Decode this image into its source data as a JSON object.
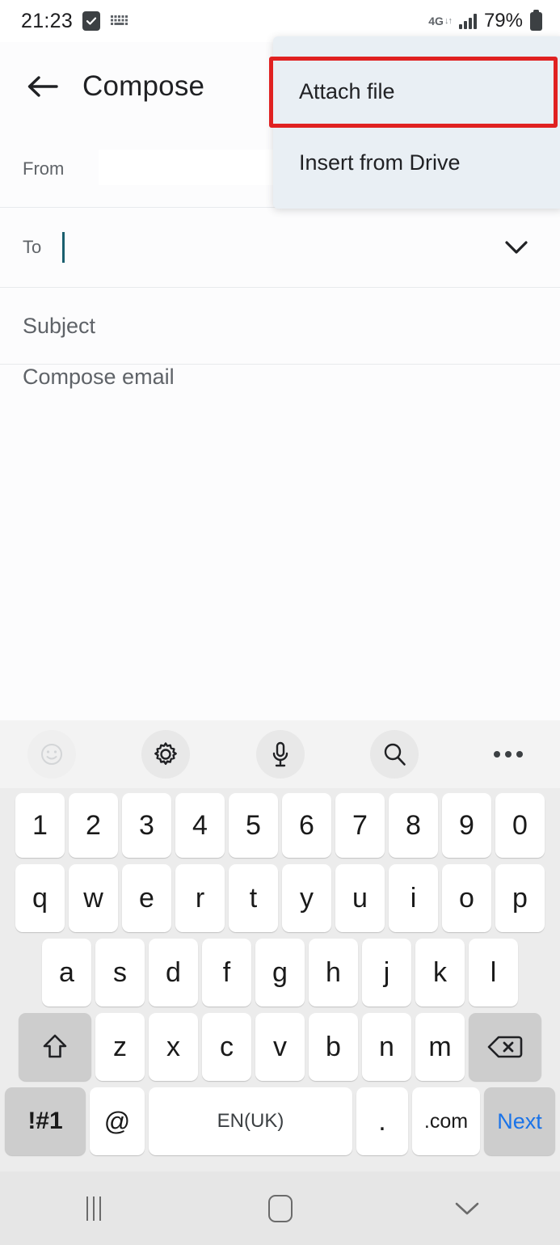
{
  "status_bar": {
    "time": "21:23",
    "check_icon": "checkbox-checked-icon",
    "keyboard_icon": "keyboard-icon",
    "network_type": "4G",
    "data_arrows": "↓↑",
    "signal_icon": "signal-bars-icon",
    "battery_percent": "79%",
    "battery_icon": "battery-full-icon"
  },
  "app_bar": {
    "back_icon": "back-arrow-icon",
    "title": "Compose"
  },
  "compose": {
    "from_label": "From",
    "from_value": "",
    "from_trailing": ")",
    "to_label": "To",
    "to_value": "",
    "to_expand_icon": "chevron-down-icon",
    "subject_placeholder": "Subject",
    "subject_value": "",
    "body_placeholder": "Compose email",
    "body_value": ""
  },
  "overflow_menu": {
    "visible": true,
    "background_color": "#e9eff4",
    "highlight_color": "#e02121",
    "items": [
      {
        "label": "Attach file",
        "highlighted": true
      },
      {
        "label": "Insert from Drive",
        "highlighted": false
      }
    ]
  },
  "keyboard": {
    "toolbar": [
      {
        "name": "emoji-icon",
        "label": ""
      },
      {
        "name": "gear-icon",
        "label": ""
      },
      {
        "name": "microphone-icon",
        "label": ""
      },
      {
        "name": "search-icon",
        "label": ""
      },
      {
        "name": "overflow-dots-icon",
        "label": ""
      }
    ],
    "row_numbers": [
      "1",
      "2",
      "3",
      "4",
      "5",
      "6",
      "7",
      "8",
      "9",
      "0"
    ],
    "row_top": [
      "q",
      "w",
      "e",
      "r",
      "t",
      "y",
      "u",
      "i",
      "o",
      "p"
    ],
    "row_home": [
      "a",
      "s",
      "d",
      "f",
      "g",
      "h",
      "j",
      "k",
      "l"
    ],
    "row_bottom": [
      "z",
      "x",
      "c",
      "v",
      "b",
      "n",
      "m"
    ],
    "shift_icon": "shift-arrow-icon",
    "backspace_icon": "backspace-icon",
    "symbols_key": "!#1",
    "at_key": "@",
    "space_key": "EN(UK)",
    "period_key": ".",
    "dotcom_key": ".com",
    "action_key": "Next",
    "action_key_color": "#1a73e8"
  },
  "nav_bar": {
    "recents_icon": "recents-icon",
    "home_icon": "home-icon",
    "hide_keyboard_icon": "chevron-down-icon"
  }
}
